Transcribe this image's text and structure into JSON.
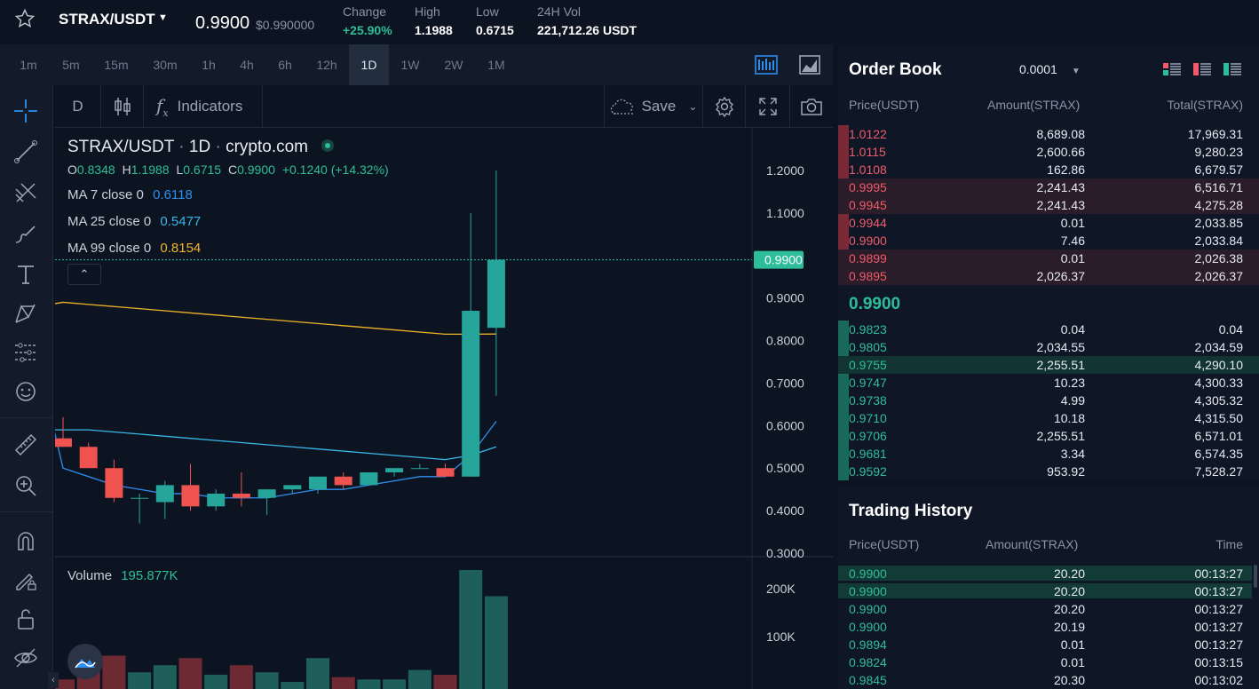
{
  "header": {
    "pair": "STRAX/USDT",
    "price": "0.9900",
    "price_usd": "$0.990000",
    "stats": [
      {
        "label": "Change",
        "value": "+25.90%"
      },
      {
        "label": "High",
        "value": "1.1988"
      },
      {
        "label": "Low",
        "value": "0.6715"
      },
      {
        "label": "24H Vol",
        "value": "221,712.26 USDT"
      }
    ]
  },
  "timeframes": [
    "1m",
    "5m",
    "15m",
    "30m",
    "1h",
    "4h",
    "6h",
    "12h",
    "1D",
    "1W",
    "2W",
    "1M"
  ],
  "active_timeframe": "1D",
  "toolbar": {
    "interval": "D",
    "indicators": "Indicators",
    "save": "Save"
  },
  "chart": {
    "title": "STRAX/USDT",
    "interval": "1D",
    "source": "crypto.com",
    "ohlc": {
      "o_label": "O",
      "o": "0.8348",
      "h_label": "H",
      "h": "1.1988",
      "l_label": "L",
      "l": "0.6715",
      "c_label": "C",
      "c": "0.9900",
      "change": "+0.1240 (+14.32%)"
    },
    "ma": [
      {
        "label": "MA 7 close 0",
        "value": "0.6118",
        "color": "#2f8ff0"
      },
      {
        "label": "MA 25 close 0",
        "value": "0.5477",
        "color": "#38b6e8"
      },
      {
        "label": "MA 99 close 0",
        "value": "0.8154",
        "color": "#f0b429"
      }
    ],
    "price_axis": [
      "1.2000",
      "1.1000",
      "1.0000",
      "0.9000",
      "0.8000",
      "0.7000",
      "0.6000",
      "0.5000",
      "0.4000",
      "0.3000"
    ],
    "last_price": "0.9900",
    "volume_label": "Volume",
    "volume_value": "195.877K",
    "volume_axis": [
      "200K",
      "100K"
    ]
  },
  "chart_data": {
    "type": "candlestick",
    "ylim": [
      0.3,
      1.2
    ],
    "candles": [
      {
        "o": 0.57,
        "h": 0.62,
        "l": 0.55,
        "c": 0.55
      },
      {
        "o": 0.55,
        "h": 0.56,
        "l": 0.5,
        "c": 0.5
      },
      {
        "o": 0.5,
        "h": 0.52,
        "l": 0.42,
        "c": 0.43
      },
      {
        "o": 0.43,
        "h": 0.44,
        "l": 0.37,
        "c": 0.43
      },
      {
        "o": 0.42,
        "h": 0.47,
        "l": 0.38,
        "c": 0.46
      },
      {
        "o": 0.46,
        "h": 0.51,
        "l": 0.4,
        "c": 0.41
      },
      {
        "o": 0.41,
        "h": 0.45,
        "l": 0.4,
        "c": 0.44
      },
      {
        "o": 0.44,
        "h": 0.49,
        "l": 0.41,
        "c": 0.43
      },
      {
        "o": 0.43,
        "h": 0.45,
        "l": 0.39,
        "c": 0.45
      },
      {
        "o": 0.45,
        "h": 0.46,
        "l": 0.44,
        "c": 0.46
      },
      {
        "o": 0.45,
        "h": 0.48,
        "l": 0.44,
        "c": 0.48
      },
      {
        "o": 0.48,
        "h": 0.49,
        "l": 0.45,
        "c": 0.46
      },
      {
        "o": 0.46,
        "h": 0.49,
        "l": 0.46,
        "c": 0.49
      },
      {
        "o": 0.49,
        "h": 0.5,
        "l": 0.48,
        "c": 0.5
      },
      {
        "o": 0.5,
        "h": 0.51,
        "l": 0.5,
        "c": 0.5
      },
      {
        "o": 0.5,
        "h": 0.51,
        "l": 0.48,
        "c": 0.48
      },
      {
        "o": 0.48,
        "h": 1.1,
        "l": 0.48,
        "c": 0.87
      },
      {
        "o": 0.83,
        "h": 1.2,
        "l": 0.67,
        "c": 0.99
      }
    ],
    "ma7": [
      0.5,
      0.48,
      0.46,
      0.45,
      0.44,
      0.44,
      0.43,
      0.43,
      0.43,
      0.44,
      0.45,
      0.45,
      0.46,
      0.47,
      0.48,
      0.48,
      0.53,
      0.61
    ],
    "ma25": [
      0.59,
      0.59,
      0.585,
      0.58,
      0.575,
      0.57,
      0.565,
      0.56,
      0.555,
      0.55,
      0.545,
      0.54,
      0.535,
      0.53,
      0.525,
      0.52,
      0.53,
      0.55
    ],
    "ma99": [
      0.89,
      0.885,
      0.88,
      0.875,
      0.87,
      0.865,
      0.86,
      0.855,
      0.85,
      0.845,
      0.84,
      0.835,
      0.83,
      0.825,
      0.82,
      0.815,
      0.815,
      0.8154
    ],
    "volume": [
      8,
      18,
      28,
      14,
      20,
      26,
      12,
      20,
      14,
      6,
      26,
      10,
      8,
      8,
      16,
      12,
      100,
      78
    ]
  },
  "order_book": {
    "title": "Order Book",
    "precision": "0.0001",
    "columns": [
      "Price(USDT)",
      "Amount(STRAX)",
      "Total(STRAX)"
    ],
    "asks": [
      {
        "price": "1.0122",
        "amount": "8,689.08",
        "total": "17,969.31",
        "depth": 0.05
      },
      {
        "price": "1.0115",
        "amount": "2,600.66",
        "total": "9,280.23",
        "depth": 0.05
      },
      {
        "price": "1.0108",
        "amount": "162.86",
        "total": "6,679.57",
        "depth": 0.05
      },
      {
        "price": "0.9995",
        "amount": "2,241.43",
        "total": "6,516.71",
        "depth": 1.0
      },
      {
        "price": "0.9945",
        "amount": "2,241.43",
        "total": "4,275.28",
        "depth": 1.0
      },
      {
        "price": "0.9944",
        "amount": "0.01",
        "total": "2,033.85",
        "depth": 0.05
      },
      {
        "price": "0.9900",
        "amount": "7.46",
        "total": "2,033.84",
        "depth": 0.05
      },
      {
        "price": "0.9899",
        "amount": "0.01",
        "total": "2,026.38",
        "depth": 1.0
      },
      {
        "price": "0.9895",
        "amount": "2,026.37",
        "total": "2,026.37",
        "depth": 1.0
      }
    ],
    "mid": "0.9900",
    "bids": [
      {
        "price": "0.9823",
        "amount": "0.04",
        "total": "0.04",
        "depth": 0.05
      },
      {
        "price": "0.9805",
        "amount": "2,034.55",
        "total": "2,034.59",
        "depth": 0.05
      },
      {
        "price": "0.9755",
        "amount": "2,255.51",
        "total": "4,290.10",
        "depth": 1.0
      },
      {
        "price": "0.9747",
        "amount": "10.23",
        "total": "4,300.33",
        "depth": 0.05
      },
      {
        "price": "0.9738",
        "amount": "4.99",
        "total": "4,305.32",
        "depth": 0.05
      },
      {
        "price": "0.9710",
        "amount": "10.18",
        "total": "4,315.50",
        "depth": 0.05
      },
      {
        "price": "0.9706",
        "amount": "2,255.51",
        "total": "6,571.01",
        "depth": 0.05
      },
      {
        "price": "0.9681",
        "amount": "3.34",
        "total": "6,574.35",
        "depth": 0.05
      },
      {
        "price": "0.9592",
        "amount": "953.92",
        "total": "7,528.27",
        "depth": 0.05
      }
    ]
  },
  "trading_history": {
    "title": "Trading History",
    "columns": [
      "Price(USDT)",
      "Amount(STRAX)",
      "Time"
    ],
    "rows": [
      {
        "price": "0.9900",
        "amount": "20.20",
        "time": "00:13:27",
        "hl": true
      },
      {
        "price": "0.9900",
        "amount": "20.20",
        "time": "00:13:27",
        "hl": true
      },
      {
        "price": "0.9900",
        "amount": "20.20",
        "time": "00:13:27",
        "hl": false
      },
      {
        "price": "0.9900",
        "amount": "20.19",
        "time": "00:13:27",
        "hl": false
      },
      {
        "price": "0.9894",
        "amount": "0.01",
        "time": "00:13:27",
        "hl": false
      },
      {
        "price": "0.9824",
        "amount": "0.01",
        "time": "00:13:15",
        "hl": false
      },
      {
        "price": "0.9845",
        "amount": "20.30",
        "time": "00:13:02",
        "hl": false
      }
    ]
  },
  "colors": {
    "up": "#26a69a",
    "down": "#ef5350",
    "bg": "#0d1421",
    "accent": "#2ebd9b"
  }
}
